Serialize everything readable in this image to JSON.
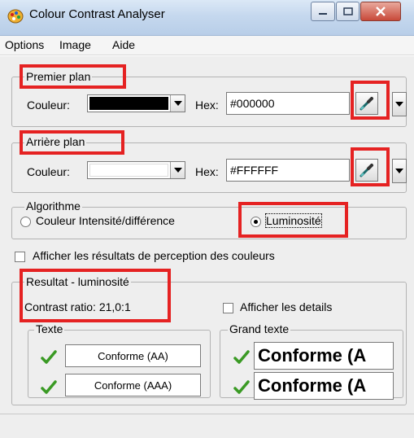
{
  "window": {
    "title": "Colour Contrast Analyser"
  },
  "menu": [
    "Options",
    "Image",
    "Aide"
  ],
  "foreground": {
    "legend": "Premier plan",
    "colour_label": "Couleur:",
    "colour_value": "#000000",
    "hex_label": "Hex:",
    "hex_value": "#000000"
  },
  "background": {
    "legend": "Arrière plan",
    "colour_label": "Couleur:",
    "colour_value": "#FFFFFF",
    "hex_label": "Hex:",
    "hex_value": "#FFFFFF"
  },
  "algorithm": {
    "legend": "Algorithme",
    "option_1": "Couleur Intensité/différence",
    "option_2": "Luminosité",
    "selected": "Luminosité"
  },
  "show_perception_label": "Afficher les résultats de perception des couleurs",
  "result": {
    "legend": "Resultat - luminosité",
    "contrast_ratio": "Contrast ratio: 21,0:1",
    "show_details_label": "Afficher les details",
    "text_group": {
      "legend": "Texte",
      "aa": "Conforme (AA)",
      "aaa": "Conforme (AAA)"
    },
    "large_text_group": {
      "legend": "Grand texte",
      "aa": "Conforme (A",
      "aaa": "Conforme (A"
    }
  },
  "colors": {
    "highlight": "#e52222",
    "check": "#3a9a24"
  }
}
